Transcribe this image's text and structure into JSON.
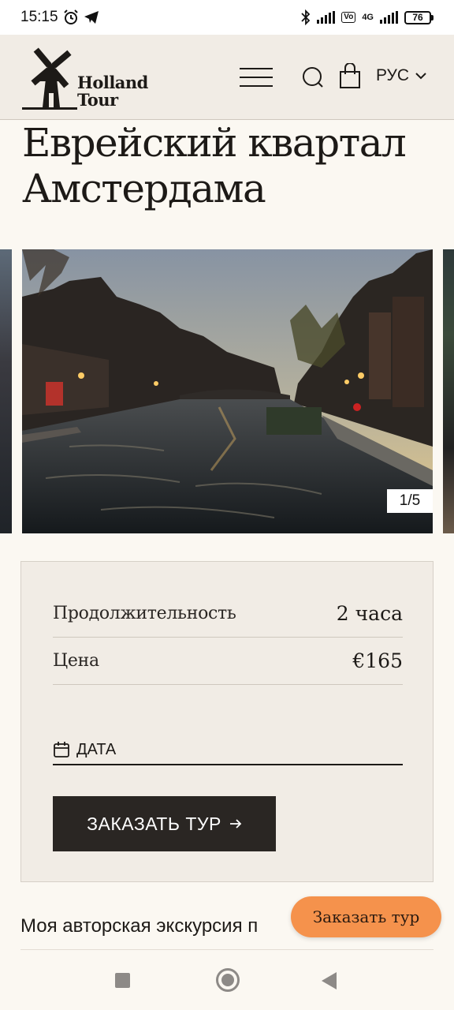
{
  "status_bar": {
    "time": "15:15",
    "network": "4G",
    "battery": "76"
  },
  "header": {
    "logo_line1": "Holland",
    "logo_line2": "Tour",
    "language": "РУС"
  },
  "page": {
    "title": "Еврейский квартал Амстердама"
  },
  "gallery": {
    "counter": "1/5"
  },
  "booking": {
    "duration_label": "Продолжительность",
    "duration_value": "2 часа",
    "price_label": "Цена",
    "price_value": "€165",
    "date_placeholder": "ДАТА",
    "order_button": "ЗАКАЗАТЬ ТУР"
  },
  "intro_text": "Моя авторская экскурсия п",
  "fab_label": "Заказать тур",
  "colors": {
    "header_bg": "#f1ece5",
    "page_bg": "#fbf8f2",
    "button_dark": "#2a2623",
    "fab_orange": "#f5924c"
  }
}
